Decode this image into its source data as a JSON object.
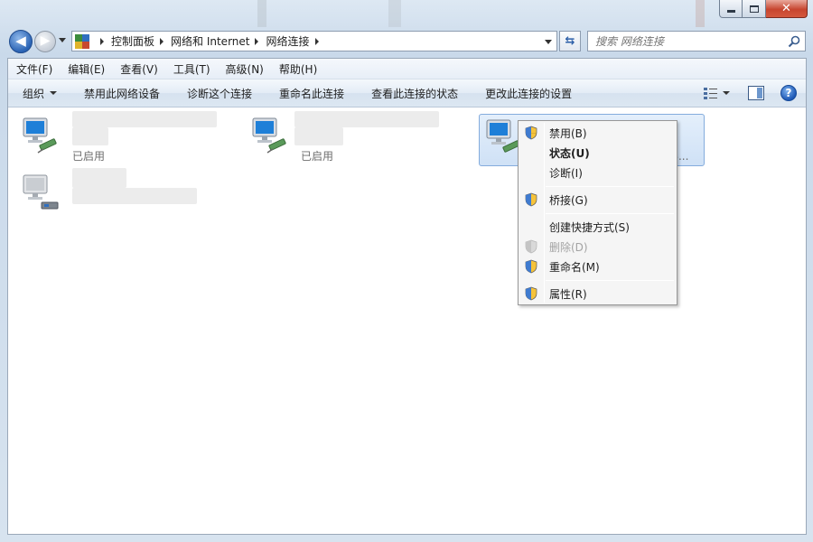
{
  "window": {
    "caption_min": "–",
    "caption_max": "□",
    "caption_close": "✕"
  },
  "address": {
    "crumbs": [
      "控制面板",
      "网络和 Internet",
      "网络连接"
    ]
  },
  "search": {
    "placeholder": "搜索 网络连接"
  },
  "menubar": {
    "items": [
      "文件(F)",
      "编辑(E)",
      "查看(V)",
      "工具(T)",
      "高级(N)",
      "帮助(H)"
    ]
  },
  "commandbar": {
    "organize": "组织",
    "disable": "禁用此网络设备",
    "diagnose": "诊断这个连接",
    "rename": "重命名此连接",
    "view_status": "查看此连接的状态",
    "change_settings": "更改此连接的设置"
  },
  "connections": [
    {
      "status": "已启用"
    },
    {
      "status": "已启用"
    },
    {
      "status": "",
      "partial_text": "Y8..."
    }
  ],
  "context_menu": {
    "items": [
      {
        "label": "禁用(B)",
        "shield": true,
        "bold": false,
        "disabled": false
      },
      {
        "label": "状态(U)",
        "shield": false,
        "bold": true,
        "disabled": false
      },
      {
        "label": "诊断(I)",
        "shield": false,
        "bold": false,
        "disabled": false
      },
      {
        "label": "桥接(G)",
        "shield": true,
        "bold": false,
        "disabled": false
      },
      {
        "label": "创建快捷方式(S)",
        "shield": false,
        "bold": false,
        "disabled": false
      },
      {
        "label": "删除(D)",
        "shield": true,
        "bold": false,
        "disabled": true
      },
      {
        "label": "重命名(M)",
        "shield": true,
        "bold": false,
        "disabled": false
      },
      {
        "label": "属性(R)",
        "shield": true,
        "bold": false,
        "disabled": false
      }
    ]
  },
  "colors": {
    "selection": "#cfe1f6",
    "accent": "#2a63b4"
  }
}
